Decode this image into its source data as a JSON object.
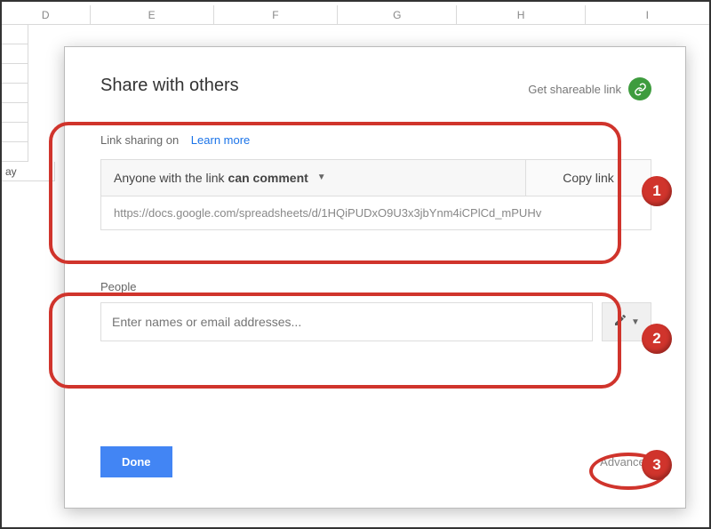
{
  "columns": [
    "D",
    "E",
    "F",
    "G",
    "H",
    "I"
  ],
  "partialCell": "ay",
  "modal": {
    "title": "Share with others",
    "getLink": "Get shareable link",
    "linkStatus": "Link sharing on",
    "learnMore": "Learn more",
    "permissionPrefix": "Anyone with the link",
    "permissionBold": "can comment",
    "copy": "Copy link",
    "url": "https://docs.google.com/spreadsheets/d/1HQiPUDxO9U3x3jbYnm4iCPlCd_mPUHv",
    "peopleLabel": "People",
    "peoplePlaceholder": "Enter names or email addresses...",
    "done": "Done",
    "advanced": "Advanced"
  },
  "annotations": {
    "b1": "1",
    "b2": "2",
    "b3": "3"
  }
}
